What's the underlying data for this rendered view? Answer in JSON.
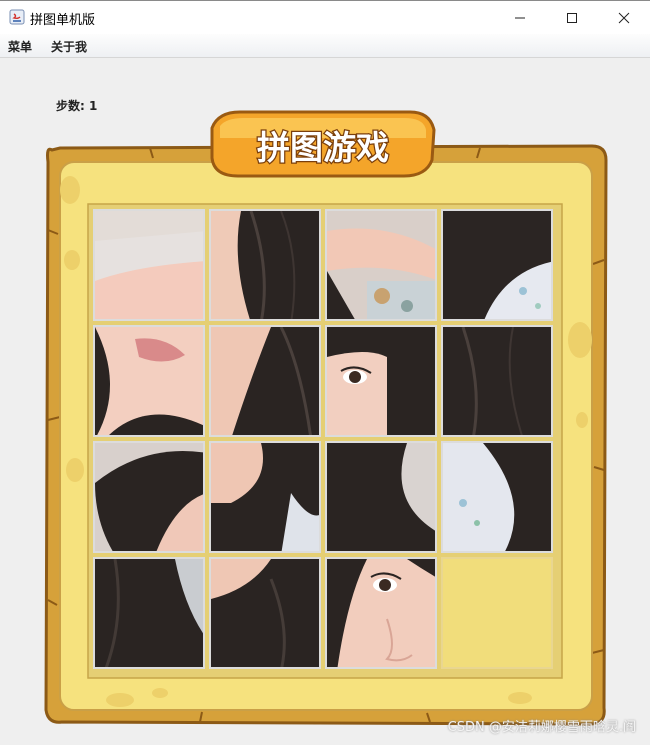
{
  "window": {
    "title": "拼图单机版",
    "icon": "java-icon",
    "controls": {
      "minimize": "—",
      "maximize": "☐",
      "close": "✕"
    }
  },
  "menubar": {
    "items": [
      "菜单",
      "关于我"
    ]
  },
  "status": {
    "steps_label": "步数: 1"
  },
  "board": {
    "banner_title": "拼图游戏",
    "frame_color": "#d9a53c",
    "inner_color": "#f6e27e",
    "grid": {
      "rows": 4,
      "cols": 4,
      "empty_tile": {
        "row": 4,
        "col": 4
      },
      "tiles": [
        {
          "row": 1,
          "col": 1,
          "content": "arm and sleeve"
        },
        {
          "row": 1,
          "col": 2,
          "content": "dark hair"
        },
        {
          "row": 1,
          "col": 3,
          "content": "arm and floral fabric"
        },
        {
          "row": 1,
          "col": 4,
          "content": "hair and shirt"
        },
        {
          "row": 2,
          "col": 1,
          "content": "lips and hair"
        },
        {
          "row": 2,
          "col": 2,
          "content": "arm and hair"
        },
        {
          "row": 2,
          "col": 3,
          "content": "eye and bangs"
        },
        {
          "row": 2,
          "col": 4,
          "content": "dark hair"
        },
        {
          "row": 3,
          "col": 1,
          "content": "hair"
        },
        {
          "row": 3,
          "col": 2,
          "content": "arm and hair"
        },
        {
          "row": 3,
          "col": 3,
          "content": "bangs"
        },
        {
          "row": 3,
          "col": 4,
          "content": "shirt and hair"
        },
        {
          "row": 4,
          "col": 1,
          "content": "hair"
        },
        {
          "row": 4,
          "col": 2,
          "content": "hair"
        },
        {
          "row": 4,
          "col": 3,
          "content": "eye and nose"
        },
        {
          "row": 4,
          "col": 4,
          "content": "empty"
        }
      ]
    }
  },
  "watermark": "CSDN @安洁莉娜樱雪雨晗灵.阎"
}
